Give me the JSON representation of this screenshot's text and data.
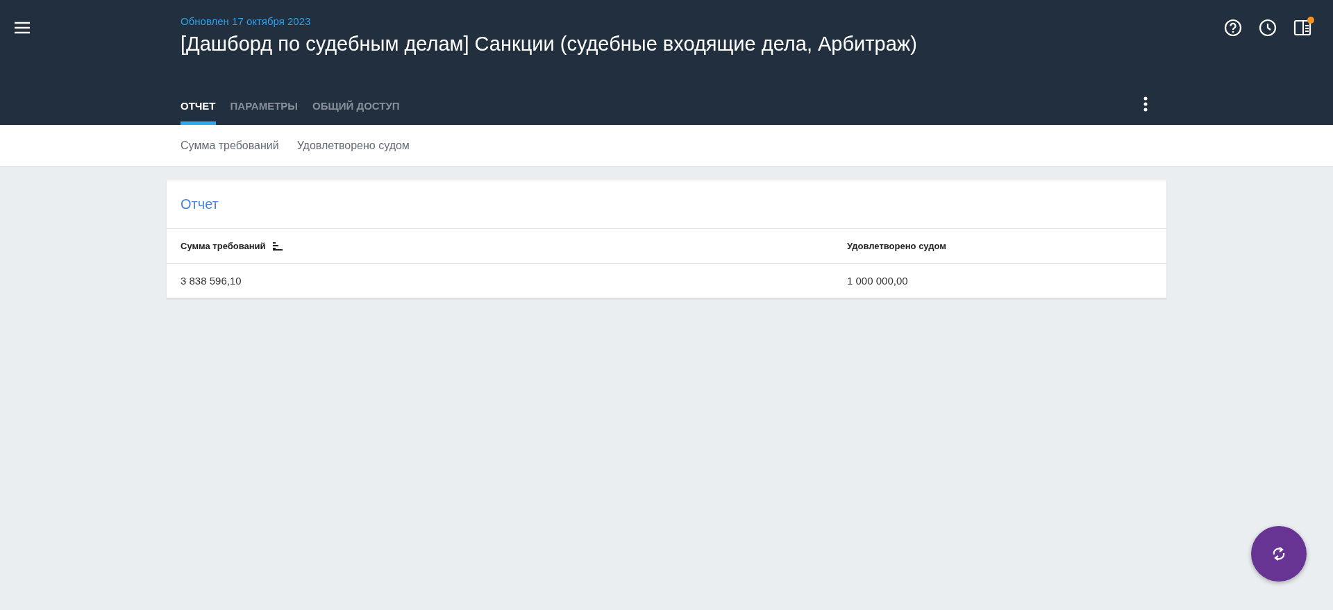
{
  "header": {
    "updated": "Обновлен 17 октября 2023",
    "title": "[Дашборд по судебным делам] Санкции (судебные входящие дела, Арбитраж)",
    "notification": true
  },
  "tabs": [
    {
      "label": "ОТЧЕТ",
      "selected": true
    },
    {
      "label": "ПАРАМЕТРЫ",
      "selected": false
    },
    {
      "label": "ОБЩИЙ ДОСТУП",
      "selected": false
    }
  ],
  "filters": [
    "Сумма требований",
    "Удовлетворено судом"
  ],
  "report": {
    "title": "Отчет",
    "columns": [
      {
        "label": "Сумма требований",
        "sorted": true
      },
      {
        "label": "Удовлетворено судом",
        "sorted": false
      }
    ],
    "rows": [
      [
        "3 838 596,10",
        "1 000 000,00"
      ]
    ]
  }
}
